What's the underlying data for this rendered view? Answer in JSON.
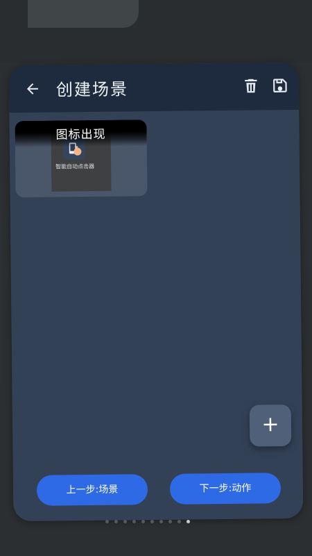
{
  "header": {
    "title": "创建场景",
    "back_icon": "arrow-left-icon",
    "trash_icon": "trash-icon",
    "save_icon": "save-icon"
  },
  "scene_tile": {
    "title": "图标出现",
    "app_label": "智能自动点击器",
    "app_icon": "phone-tap-icon"
  },
  "fab": {
    "label": "+",
    "icon": "plus-icon"
  },
  "footer": {
    "prev_label": "上一步:场景",
    "next_label": "下一步:动作"
  },
  "pager": {
    "count": 10,
    "active_index": 9
  },
  "colors": {
    "card_bg": "#334156",
    "header_bg": "#1e2a3d",
    "accent": "#2f6ae6"
  }
}
